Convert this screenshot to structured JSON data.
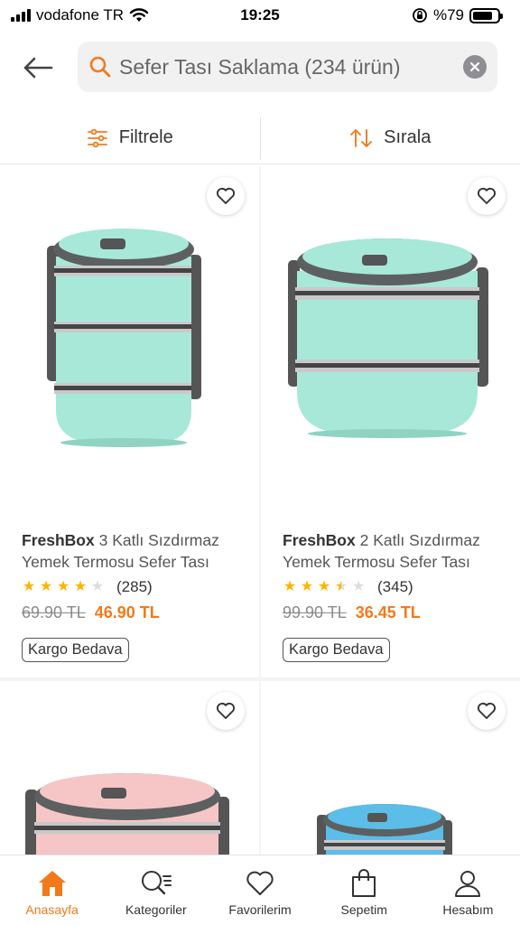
{
  "status_bar": {
    "carrier": "vodafone TR",
    "time": "19:25",
    "battery": "%79",
    "battery_level": 0.79
  },
  "search": {
    "query": "Sefer Tası Saklama (234 ürün)"
  },
  "toolbar": {
    "filter_label": "Filtrele",
    "sort_label": "Sırala"
  },
  "colors": {
    "accent": "#f27a1a",
    "star": "#ffb300",
    "product_mint": "#a8e8d8",
    "product_pink": "#f6c6c6",
    "product_blue": "#5bbde8"
  },
  "products": [
    {
      "brand": "FreshBox",
      "name": "3 Katlı Sızdırmaz Yemek Termosu Sefer Tası",
      "rating_stars": 4,
      "rating_count": "(285)",
      "old_price": "69.90 TL",
      "new_price": "46.90 TL",
      "badge": "Kargo Bedava"
    },
    {
      "brand": "FreshBox",
      "name": "2 Katlı Sızdırmaz Yemek Termosu Sefer Tası",
      "rating_stars": 3.5,
      "rating_count": "(345)",
      "old_price": "99.90 TL",
      "new_price": "36.45 TL",
      "badge": "Kargo Bedava"
    }
  ],
  "bottom_nav": [
    {
      "label": "Anasayfa",
      "icon": "home-icon",
      "active": true
    },
    {
      "label": "Kategoriler",
      "icon": "categories-search-icon",
      "active": false
    },
    {
      "label": "Favorilerim",
      "icon": "heart-icon",
      "active": false
    },
    {
      "label": "Sepetim",
      "icon": "bag-icon",
      "active": false
    },
    {
      "label": "Hesabım",
      "icon": "user-icon",
      "active": false
    }
  ]
}
